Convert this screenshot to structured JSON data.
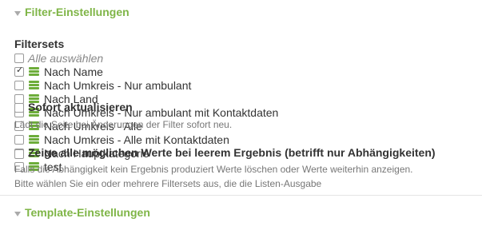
{
  "filter_section": {
    "title": "Filter-Einstellungen"
  },
  "filtersets": {
    "heading": "Filtersets",
    "select_all": "Alle auswählen",
    "items": [
      {
        "label": "Nach Name",
        "checked": true
      },
      {
        "label": "Nach Umkreis - Nur ambulant",
        "checked": false
      },
      {
        "label": "Nach Land",
        "checked": false
      },
      {
        "label": "Nach Umkreis - Nur ambulant mit Kontaktdaten",
        "checked": false
      },
      {
        "label": "Nach Umkreis - Alle",
        "checked": false
      },
      {
        "label": "Nach Umkreis - Alle mit Kontaktdaten",
        "checked": false
      },
      {
        "label": "Nach Hauptkategorie",
        "checked": false
      },
      {
        "label": "test",
        "checked": false
      }
    ],
    "help": "Bitte wählen Sie ein oder mehrere Filtersets aus, die die Listen-Ausgabe"
  },
  "sofort": {
    "label": "Sofort aktualisieren",
    "help": "Lädt die Seite bei Änderungen der Filter sofort neu."
  },
  "zeige": {
    "label": "Zeige alle möglichen Werte bei leerem Ergebnis (betrifft nur Abhängigkeiten)",
    "help": "Falls die Abhängigkeit kein Ergebnis produziert Werte löschen oder Werte weiterhin anzeigen."
  },
  "template_section": {
    "title": "Template-Einstellungen"
  },
  "colors": {
    "accent": "#7fb547",
    "icon": "#6dad3a",
    "text": "#333333",
    "muted": "#777777"
  }
}
